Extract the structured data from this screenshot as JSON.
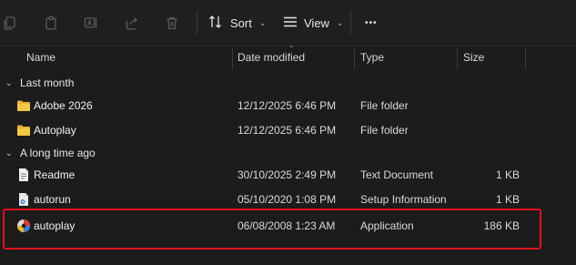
{
  "toolbar": {
    "sort_label": "Sort",
    "view_label": "View",
    "more_label": "•••"
  },
  "columns": {
    "name": "Name",
    "date": "Date modified",
    "type": "Type",
    "size": "Size"
  },
  "groups": [
    {
      "label": "Last month",
      "rows": [
        {
          "name": "Adobe 2026",
          "date": "12/12/2025 6:46 PM",
          "type": "File folder",
          "size": "",
          "icon": "folder-icon"
        },
        {
          "name": "Autoplay",
          "date": "12/12/2025 6:46 PM",
          "type": "File folder",
          "size": "",
          "icon": "folder-icon"
        }
      ]
    },
    {
      "label": "A long time ago",
      "rows": [
        {
          "name": "Readme",
          "date": "30/10/2025 2:49 PM",
          "type": "Text Document",
          "size": "1 KB",
          "icon": "text-file-icon"
        },
        {
          "name": "autorun",
          "date": "05/10/2020 1:08 PM",
          "type": "Setup Information",
          "size": "1 KB",
          "icon": "setup-file-icon"
        },
        {
          "name": "autoplay",
          "date": "06/08/2008 1:23 AM",
          "type": "Application",
          "size": "186 KB",
          "icon": "application-icon"
        }
      ]
    }
  ],
  "highlight_color": "#e0111b"
}
